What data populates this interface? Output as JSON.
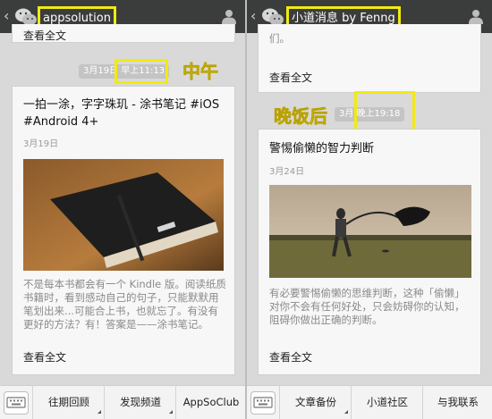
{
  "left": {
    "chat_title": "appsolution",
    "top_read_more": "查看全文",
    "timestamp": {
      "date": "3月19日",
      "time": "早上11:13"
    },
    "annotation": "中午",
    "article": {
      "title": "一拍一涂，字字珠玑 - 涂书笔记 #iOS #Android 4+",
      "date": "3月19日",
      "summary": "不是每本书都会有一个 Kindle 版。阅读纸质书籍时，看到感动自己的句子，只能默默用笔划出来...可能合上书，也就忘了。有没有更好的方法？有！答案是——涂书笔记。",
      "read_more": "查看全文"
    },
    "menu": [
      "往期回顾",
      "发现频道",
      "AppSoClub"
    ]
  },
  "right": {
    "chat_title": "小道消息 by Fenng",
    "top_snippet": "们。",
    "top_read_more": "查看全文",
    "annotation": "晚饭后",
    "timestamp": {
      "date": "3月",
      "time": "晚上19:18"
    },
    "article": {
      "title": "警惕偷懒的智力判断",
      "date": "3月24日",
      "summary": "有必要警惕偷懒的思维判断，这种「偷懒」对你不会有任何好处，只会妨碍你的认知，阻碍你做出正确的判断。",
      "read_more": "查看全文"
    },
    "menu": [
      "文章备份",
      "小道社区",
      "与我联系"
    ]
  },
  "icons": [
    "back-arrow-icon",
    "wechat-logo-icon",
    "person-icon",
    "keyboard-icon"
  ],
  "colors": {
    "titlebar": "#3b3d3c",
    "highlight": "#f2ea12",
    "background": "#d9d9d9"
  }
}
